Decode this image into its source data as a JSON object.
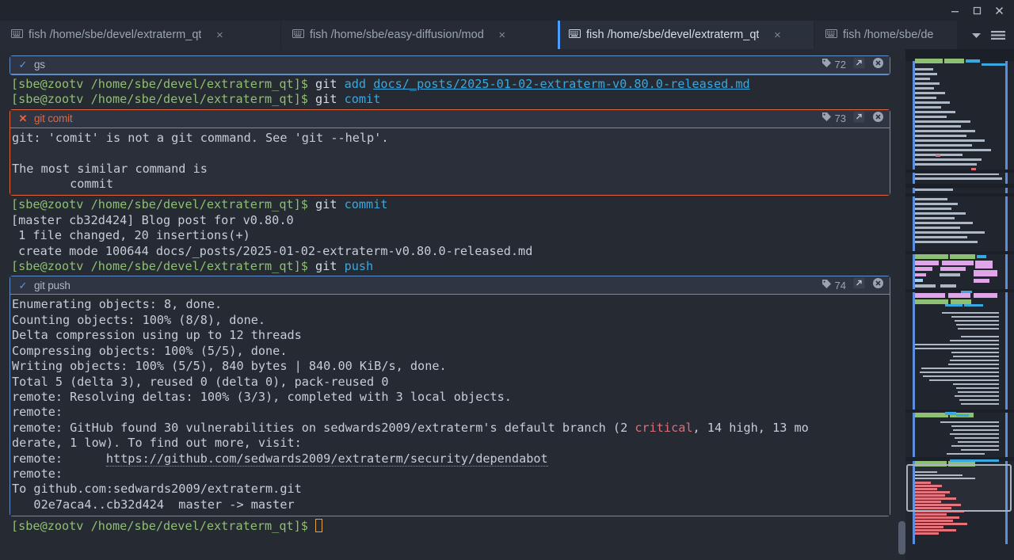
{
  "window": {
    "controls": {
      "minimize": "minimize",
      "maximize": "maximize",
      "close": "close"
    }
  },
  "tabs": [
    {
      "label": "fish /home/sbe/devel/extraterm_qt",
      "icon": "keyboard-icon",
      "active": false,
      "close": "×"
    },
    {
      "label": "fish /home/sbe/easy-diffusion/mod",
      "icon": "keyboard-icon",
      "active": false,
      "close": "×"
    },
    {
      "label": "fish /home/sbe/devel/extraterm_qt",
      "icon": "keyboard-icon",
      "active": true,
      "close": "×"
    },
    {
      "label": "fish /home/sbe/de",
      "icon": "keyboard-icon",
      "active": false,
      "close": ""
    }
  ],
  "tabbar": {
    "dropdown_icon": "chevron-down-icon",
    "menu_icon": "hamburger-menu-icon"
  },
  "terminal": {
    "prompt": "[sbe@zootv /home/sbe/devel/extraterm_qt]$",
    "frames": [
      {
        "status": "ok",
        "status_icon": "check-icon",
        "title": "gs",
        "tag_icon": "tag-icon",
        "tag": "72",
        "expand_icon": "popout-icon",
        "close_icon": "close-circle-icon",
        "body": []
      },
      {
        "status": "error",
        "status_icon": "cross-icon",
        "title": "git comit",
        "tag_icon": "tag-icon",
        "tag": "73",
        "expand_icon": "popout-icon",
        "close_icon": "close-circle-icon",
        "body": [
          "git: 'comit' is not a git command. See 'git --help'.",
          "",
          "The most similar command is",
          "        commit"
        ]
      },
      {
        "status": "ok",
        "status_icon": "check-icon",
        "title": "git push",
        "tag_icon": "tag-icon",
        "tag": "74",
        "expand_icon": "popout-icon",
        "close_icon": "close-circle-icon",
        "body": [
          "Enumerating objects: 8, done.",
          "Counting objects: 100% (8/8), done.",
          "Delta compression using up to 12 threads",
          "Compressing objects: 100% (5/5), done.",
          "Writing objects: 100% (5/5), 840 bytes | 840.00 KiB/s, done.",
          "Total 5 (delta 3), reused 0 (delta 0), pack-reused 0",
          "remote: Resolving deltas: 100% (3/3), completed with 3 local objects.",
          "remote:"
        ],
        "body_tail": [
          "remote:",
          "To github.com:sedwards2009/extraterm.git",
          "   02e7aca4..cb32d424  master -> master"
        ]
      }
    ],
    "lines": {
      "cmd_add_prefix": "git ",
      "cmd_add": "add ",
      "cmd_add_file": "docs/_posts/2025-01-02-extraterm-v0.80.0-released.md",
      "cmd_comit": "comit",
      "cmd_commit": "commit",
      "cmd_push": "push",
      "commit_out_1": "[master cb32d424] Blog post for v0.80.0",
      "commit_out_2": " 1 file changed, 20 insertions(+)",
      "commit_out_3": " create mode 100644 docs/_posts/2025-01-02-extraterm-v0.80.0-released.md",
      "vuln_pre": "remote: GitHub found 30 vulnerabilities on sedwards2009/extraterm's default branch (2 ",
      "vuln_critical": "critical",
      "vuln_post": ", 14 high, 13 mo",
      "vuln_wrap": "derate, 1 low). To find out more, visit:",
      "vuln_url_prefix": "remote:      ",
      "vuln_url": "https://github.com/sedwards2009/extraterm/security/dependabot"
    }
  },
  "colors": {
    "background": "#252a33",
    "chrome": "#21252e",
    "accent_blue": "#5b8fdd",
    "error_orange": "#e3663f",
    "prompt_green": "#8fbf72",
    "arg_blue": "#3aa8e0",
    "critical_red": "#e06c78",
    "cursor_orange": "#e8a33d"
  }
}
